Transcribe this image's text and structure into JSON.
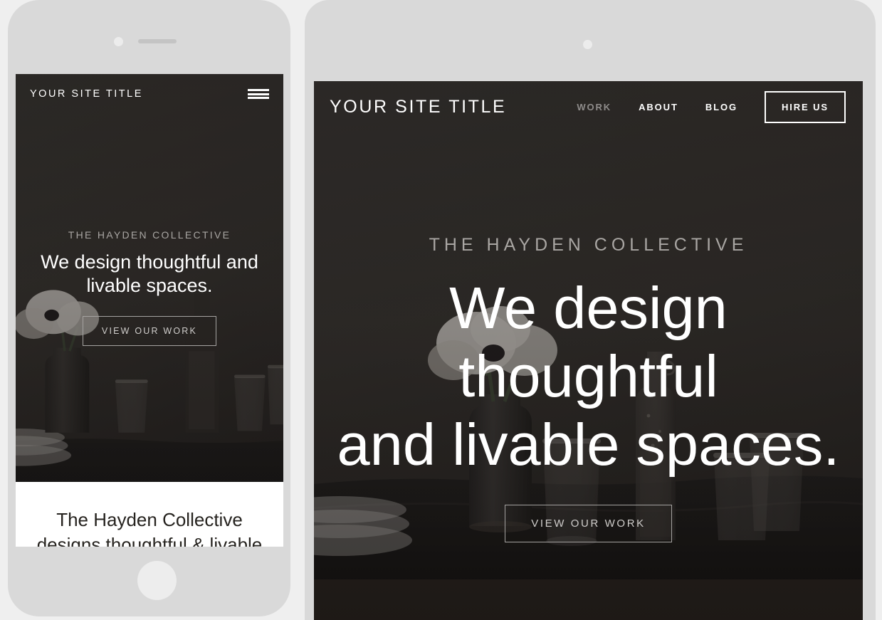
{
  "page": {
    "background_color": "#efefef"
  },
  "colors": {
    "frame": "#d9d9d9",
    "screen_dark": "#1f1d1c",
    "nav_text": "#ffffff",
    "nav_dim": "#8f8d8b",
    "eyebrow": "#a9a6a3",
    "cta_border": "#a5a3a1",
    "cta_text": "#cfcdcb",
    "about_heading": "#26231f"
  },
  "phone_mockup": {
    "name": "mobile-device-preview",
    "nav": {
      "site_title": "YOUR SITE TITLE",
      "menu_icon": "hamburger-icon"
    },
    "hero": {
      "eyebrow": "THE HAYDEN COLLECTIVE",
      "heading": "We design thoughtful and livable spaces.",
      "cta_label": "VIEW OUR WORK"
    },
    "about": {
      "heading": "The Hayden Collective",
      "heading_clipped_line": "designs thoughtful & livable"
    },
    "hardware": {
      "camera": "camera-dot",
      "speaker": "speaker-grille",
      "home_button": "home-button"
    }
  },
  "desktop_mockup": {
    "name": "desktop-device-preview",
    "nav": {
      "site_title": "YOUR SITE TITLE",
      "links": [
        {
          "label": "WORK",
          "state": "dim"
        },
        {
          "label": "ABOUT",
          "state": "normal"
        },
        {
          "label": "BLOG",
          "state": "normal"
        }
      ],
      "cta_label": "HIRE US"
    },
    "hero": {
      "eyebrow": "THE HAYDEN COLLECTIVE",
      "heading_line_1": "We design thoughtful",
      "heading_line_2": "and livable spaces.",
      "cta_label": "VIEW OUR WORK"
    },
    "hardware": {
      "camera": "camera-dot"
    }
  },
  "hero_photo": {
    "description": "dark moody still life of table setting",
    "subjects": [
      "white anemone flowers",
      "dark ceramic vase",
      "stacked plates",
      "drinking glasses",
      "water carafe",
      "dark linen table runner"
    ]
  }
}
